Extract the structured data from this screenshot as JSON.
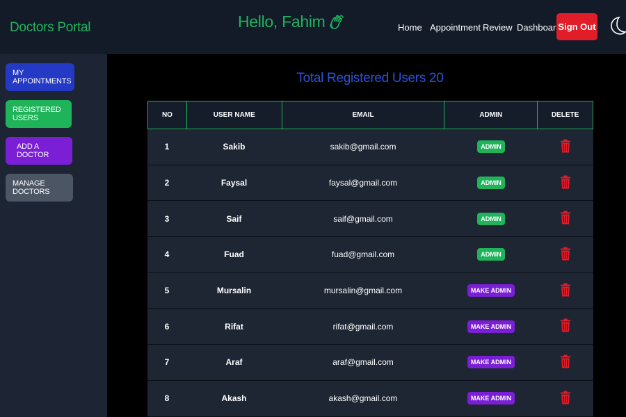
{
  "header": {
    "brand": "Doctors Portal",
    "greeting": "Hello, Fahim",
    "nav": [
      {
        "label": "Home"
      },
      {
        "label": "Appointment"
      },
      {
        "label": "Review"
      },
      {
        "label": "Dashboard"
      }
    ],
    "signout_label": "Sign Out",
    "theme_icon": "moon-icon",
    "greeting_icon": "waving-hand-icon"
  },
  "sidebar": {
    "items": [
      {
        "label": "MY APPOINTMENTS",
        "color": "#2439c4"
      },
      {
        "label": "REGISTERED USERS",
        "color": "#1fb35a"
      },
      {
        "label": "ADD A DOCTOR",
        "color": "#7b1fd6"
      },
      {
        "label": "MANAGE DOCTORS",
        "color": "#4b5563"
      }
    ]
  },
  "main": {
    "title": "Total Registered Users 20",
    "columns": [
      "NO",
      "USER NAME",
      "EMAIL",
      "ADMIN",
      "DELETE"
    ],
    "rows": [
      {
        "no": "1",
        "name": "Sakib",
        "email": "sakib@gmail.com",
        "admin": "ADMIN"
      },
      {
        "no": "2",
        "name": "Faysal",
        "email": "faysal@gmail.com",
        "admin": "ADMIN"
      },
      {
        "no": "3",
        "name": "Saif",
        "email": "saif@gmail.com",
        "admin": "ADMIN"
      },
      {
        "no": "4",
        "name": "Fuad",
        "email": "fuad@gmail.com",
        "admin": "ADMIN"
      },
      {
        "no": "5",
        "name": "Mursalin",
        "email": "mursalin@gmail.com",
        "admin": "MAKE ADMIN"
      },
      {
        "no": "6",
        "name": "Rifat",
        "email": "rifat@gmail.com",
        "admin": "MAKE ADMIN"
      },
      {
        "no": "7",
        "name": "Araf",
        "email": "araf@gmail.com",
        "admin": "MAKE ADMIN"
      },
      {
        "no": "8",
        "name": "Akash",
        "email": "akash@gmail.com",
        "admin": "MAKE ADMIN"
      }
    ],
    "delete_icon": "trash-icon"
  },
  "colors": {
    "brand_green": "#1fb35a",
    "title_blue": "#2a53d6",
    "danger_red": "#e11d2a",
    "make_admin_purple": "#7b1fd6"
  }
}
